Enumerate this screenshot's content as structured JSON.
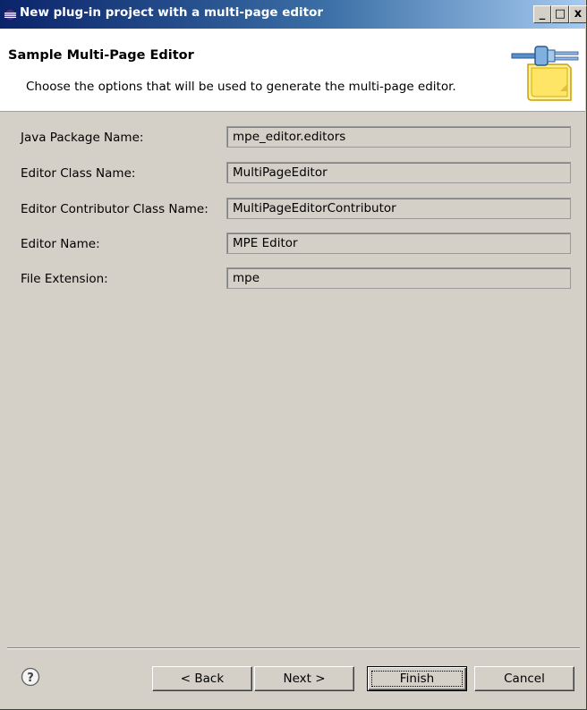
{
  "window": {
    "title": "New plug-in project with a multi-page editor",
    "minimize_label": "_",
    "maximize_label": "□",
    "close_label": "x"
  },
  "header": {
    "title": "Sample Multi-Page Editor",
    "description": "Choose the options that will be used to generate the multi-page editor."
  },
  "form": {
    "fields": [
      {
        "label": "Java Package Name:",
        "value": "mpe_editor.editors"
      },
      {
        "label": "Editor Class Name:",
        "value": "MultiPageEditor"
      },
      {
        "label": "Editor Contributor Class Name:",
        "value": "MultiPageEditorContributor"
      },
      {
        "label": "Editor Name:",
        "value": "MPE Editor"
      },
      {
        "label": "File Extension:",
        "value": "mpe"
      }
    ]
  },
  "buttons": {
    "help_icon": "question-mark-circle",
    "back_label": "< Back",
    "next_label": "Next >",
    "finish_label": "Finish",
    "cancel_label": "Cancel"
  },
  "colors": {
    "titlebar_start": "#0a246a",
    "titlebar_end": "#a6caf0",
    "dialog_bg": "#d4d0c8",
    "header_bg": "#ffffff"
  }
}
